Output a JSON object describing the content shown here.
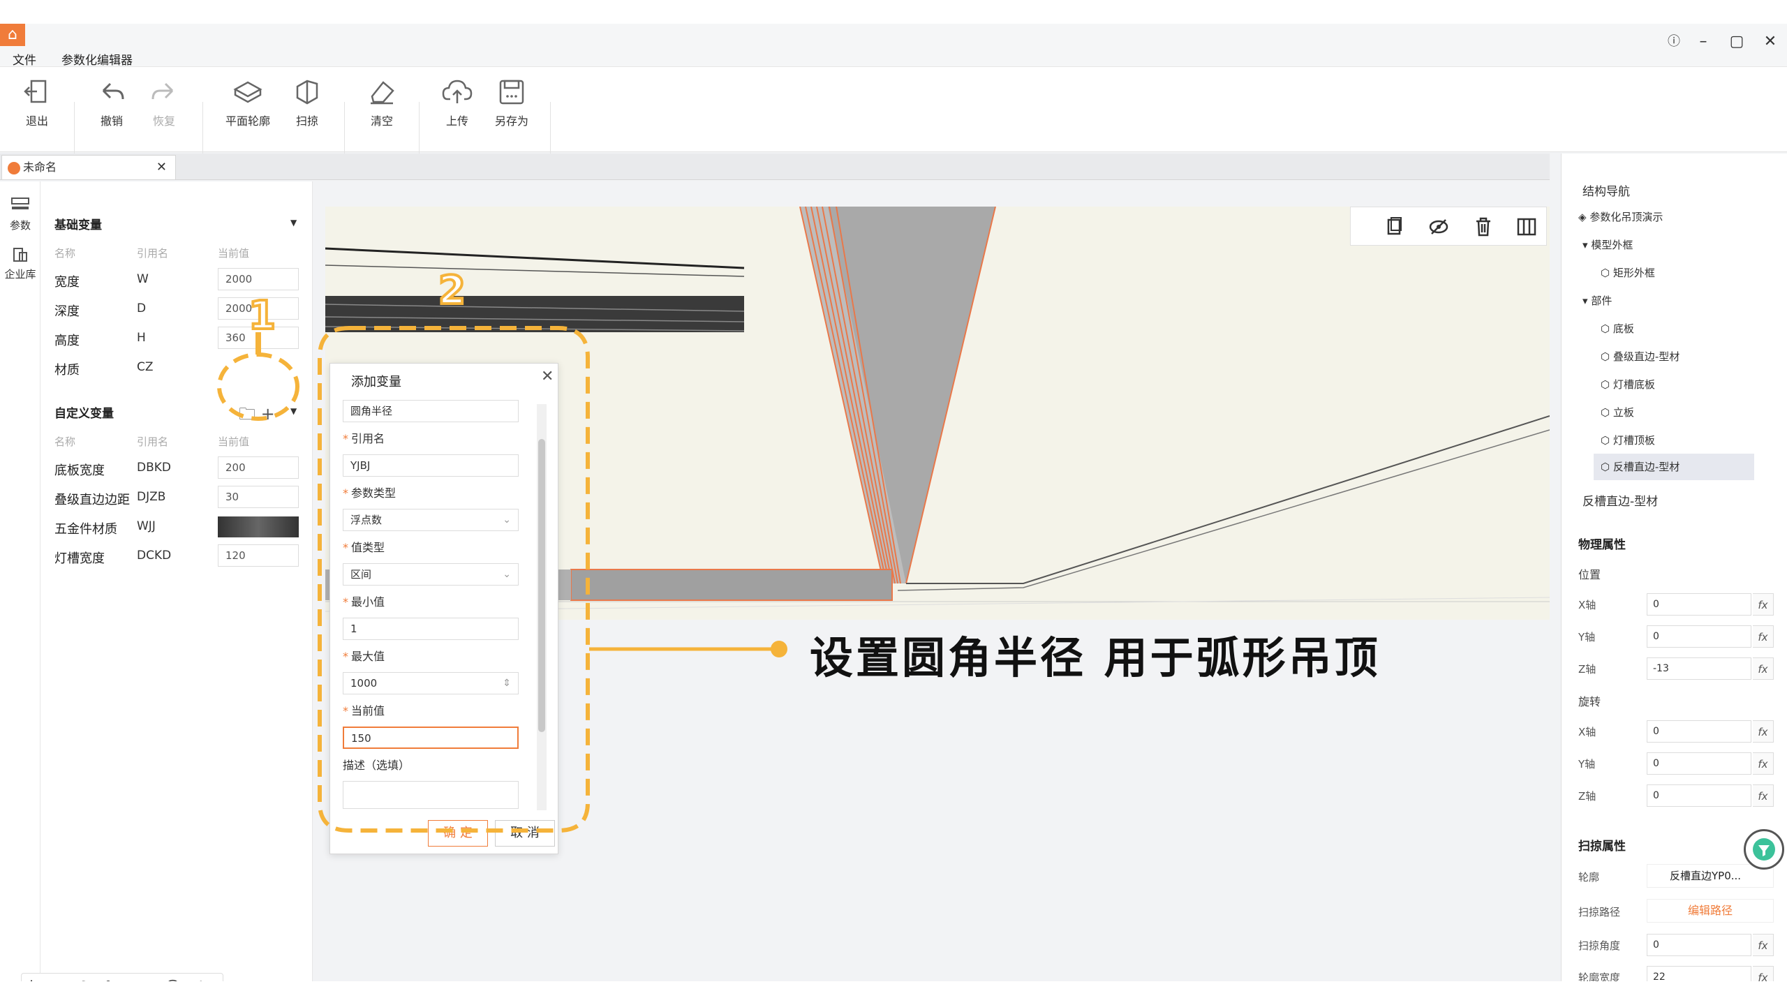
{
  "menu": {
    "file": "文件",
    "editor": "参数化编辑器"
  },
  "toolbar": {
    "exit": "退出",
    "undo": "撤销",
    "redo": "恢复",
    "plane": "平面轮廓",
    "sweep": "扫掠",
    "clear": "清空",
    "upload": "上传",
    "save_as": "另存为"
  },
  "doc_tab": {
    "name": "未命名"
  },
  "side_strip": {
    "params": "参数",
    "library": "企业库"
  },
  "basic_vars": {
    "title": "基础变量",
    "headers": {
      "name": "名称",
      "ref": "引用名",
      "value": "当前值"
    },
    "rows": [
      {
        "name": "宽度",
        "ref": "W",
        "value": "2000"
      },
      {
        "name": "深度",
        "ref": "D",
        "value": "2000"
      },
      {
        "name": "高度",
        "ref": "H",
        "value": "360"
      },
      {
        "name": "材质",
        "ref": "CZ",
        "value": ""
      }
    ]
  },
  "custom_vars": {
    "title": "自定义变量",
    "headers": {
      "name": "名称",
      "ref": "引用名",
      "value": "当前值"
    },
    "rows": [
      {
        "name": "底板宽度",
        "ref": "DBKD",
        "value": "200"
      },
      {
        "name": "叠级直边边距",
        "ref": "DJZB",
        "value": "30"
      },
      {
        "name": "五金件材质",
        "ref": "WJJ",
        "value": ""
      },
      {
        "name": "灯槽宽度",
        "ref": "DCKD",
        "value": "120"
      }
    ]
  },
  "dialog": {
    "title": "添加变量",
    "name_value": "圆角半径",
    "ref_label": "引用名",
    "ref_value": "YJBJ",
    "param_type_label": "参数类型",
    "param_type_value": "浮点数",
    "value_type_label": "值类型",
    "value_type_value": "区间",
    "min_label": "最小值",
    "min_value": "1",
    "max_label": "最大值",
    "max_value": "1000",
    "current_label": "当前值",
    "current_value": "150",
    "desc_label": "描述（选填）",
    "ok": "确 定",
    "cancel": "取 消"
  },
  "annotation": {
    "step1": "1",
    "step2": "2",
    "caption": "设置圆角半径  用于弧形吊顶"
  },
  "nav": {
    "title": "结构导航",
    "root": "参数化吊顶演示",
    "model_frame": "模型外框",
    "rect_frame": "矩形外框",
    "parts": "部件",
    "items": [
      "底板",
      "叠级直边-型材",
      "灯槽底板",
      "立板",
      "灯槽顶板",
      "反槽直边-型材"
    ]
  },
  "props": {
    "selected_name": "反槽直边-型材",
    "physical": "物理属性",
    "position": "位置",
    "rotation": "旋转",
    "x": "X轴",
    "y": "Y轴",
    "z": "Z轴",
    "pos": [
      "0",
      "0",
      "-13"
    ],
    "rot": [
      "0",
      "0",
      "0"
    ],
    "sweep": "扫掠属性",
    "profile_label": "轮廓",
    "profile_value": "反槽直边YP0...",
    "path_label": "扫掠路径",
    "edit_path": "编辑路径",
    "angle_label": "扫掠角度",
    "angle_value": "0",
    "width_label": "轮廓宽度",
    "width_value": "22",
    "fx": "fx"
  },
  "ime": {
    "cursor": "|",
    "lang": "中",
    "moon": "☽",
    "punct": "°,",
    "simp": "简",
    "emoji": "☺",
    "settings": "⚙"
  },
  "colors": {
    "accent": "#f07c3a",
    "annotation": "#f5b33a",
    "highlight": "#e9784a"
  }
}
